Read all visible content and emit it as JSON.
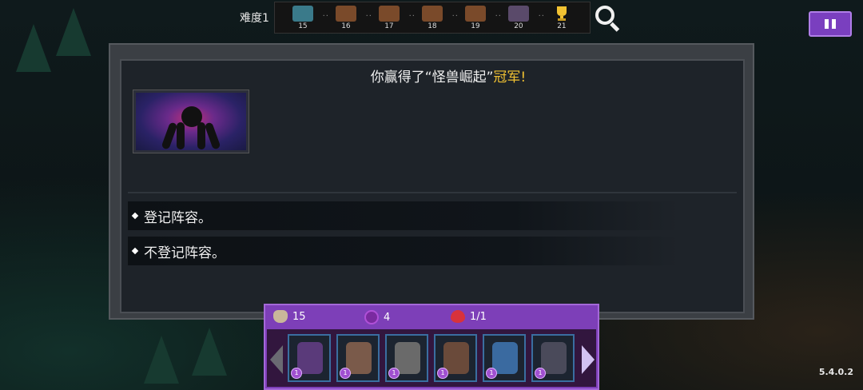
{
  "topbar": {
    "difficulty_label": "难度1",
    "stages": [
      {
        "num": "15",
        "kind": "boss"
      },
      {
        "num": "16",
        "kind": "normal"
      },
      {
        "num": "17",
        "kind": "normal"
      },
      {
        "num": "18",
        "kind": "normal"
      },
      {
        "num": "19",
        "kind": "normal"
      },
      {
        "num": "20",
        "kind": "final"
      },
      {
        "num": "21",
        "kind": "trophy"
      }
    ]
  },
  "dialog": {
    "title_prefix": "你赢得了“怪兽崛起”",
    "title_highlight": "冠军!",
    "highlight_color": "#f2c232",
    "options": [
      {
        "label": "登记阵容。"
      },
      {
        "label": "不登记阵容。"
      }
    ]
  },
  "resources": {
    "gold": "15",
    "gems": "4",
    "lives": "1/1"
  },
  "units": [
    {
      "level": "1",
      "color": "#5a3a7a"
    },
    {
      "level": "1",
      "color": "#7a5a4a"
    },
    {
      "level": "1",
      "color": "#6a6a6a"
    },
    {
      "level": "1",
      "color": "#6a4a3a"
    },
    {
      "level": "1",
      "color": "#3a6aa0"
    },
    {
      "level": "1",
      "color": "#4a4a5a"
    }
  ],
  "version": "5.4.0.2",
  "colors": {
    "accent_purple": "#7d3fb8",
    "pause_purple": "#7a3fbf"
  }
}
